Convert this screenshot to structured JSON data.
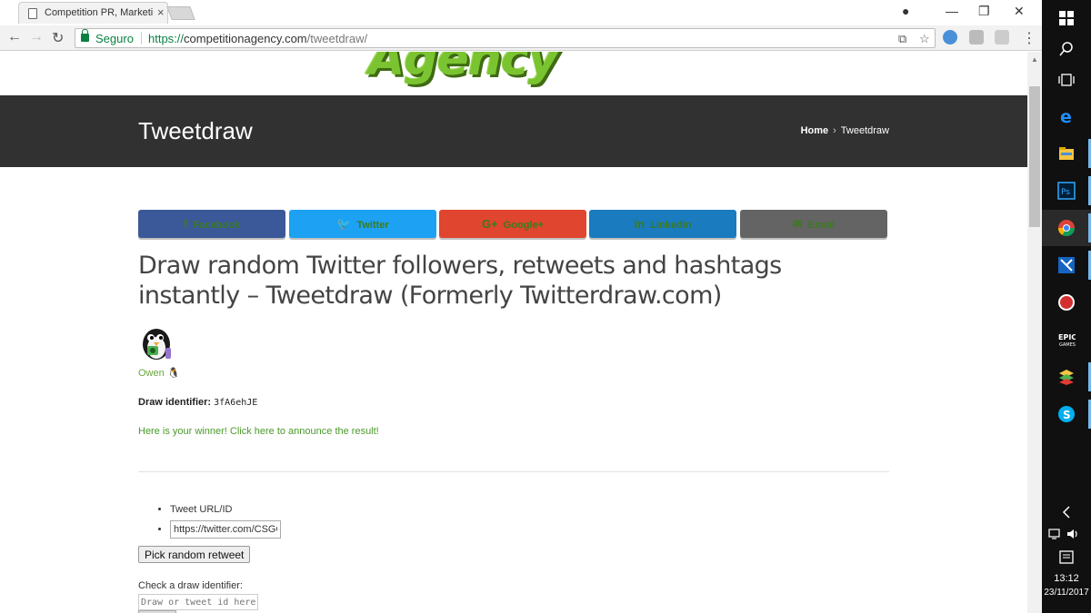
{
  "browser": {
    "tab_title": "Competition PR, Marketi",
    "secure_label": "Seguro",
    "url_scheme": "https://",
    "url_host": "competitionagency.com",
    "url_path": "/tweetdraw/"
  },
  "page": {
    "logo_text": "Agency",
    "title": "Tweetdraw",
    "breadcrumb": {
      "home": "Home",
      "separator": "›",
      "current": "Tweetdraw"
    },
    "share_buttons": [
      {
        "label": "Facebook",
        "icon": "f",
        "color": "#3b5998"
      },
      {
        "label": "Twitter",
        "icon": "🐦",
        "color": "#1da1f2"
      },
      {
        "label": "Google+",
        "icon": "G+",
        "color": "#e0452f"
      },
      {
        "label": "LinkedIn",
        "icon": "in",
        "color": "#1a7bbe"
      },
      {
        "label": "Email",
        "icon": "✉",
        "color": "#646464"
      }
    ],
    "headline": "Draw random Twitter followers, retweets and hashtags instantly – Tweetdraw (Formerly Twitterdraw.com)",
    "winner_name": "Owen",
    "winner_suffix_icon": "linux-penguin-icon",
    "draw_identifier_label": "Draw identifier:",
    "draw_identifier_value": "3fA6ehJE",
    "announce_link": "Here is your winner! Click here to announce the result!",
    "tweet_url_label": "Tweet URL/ID",
    "tweet_url_value": "https://twitter.com/CSGO",
    "pick_button": "Pick random retweet",
    "check_label": "Check a draw identifier:",
    "check_placeholder": "Draw or tweet id here"
  },
  "taskbar": {
    "time": "13:12",
    "date": "23/11/2017"
  }
}
